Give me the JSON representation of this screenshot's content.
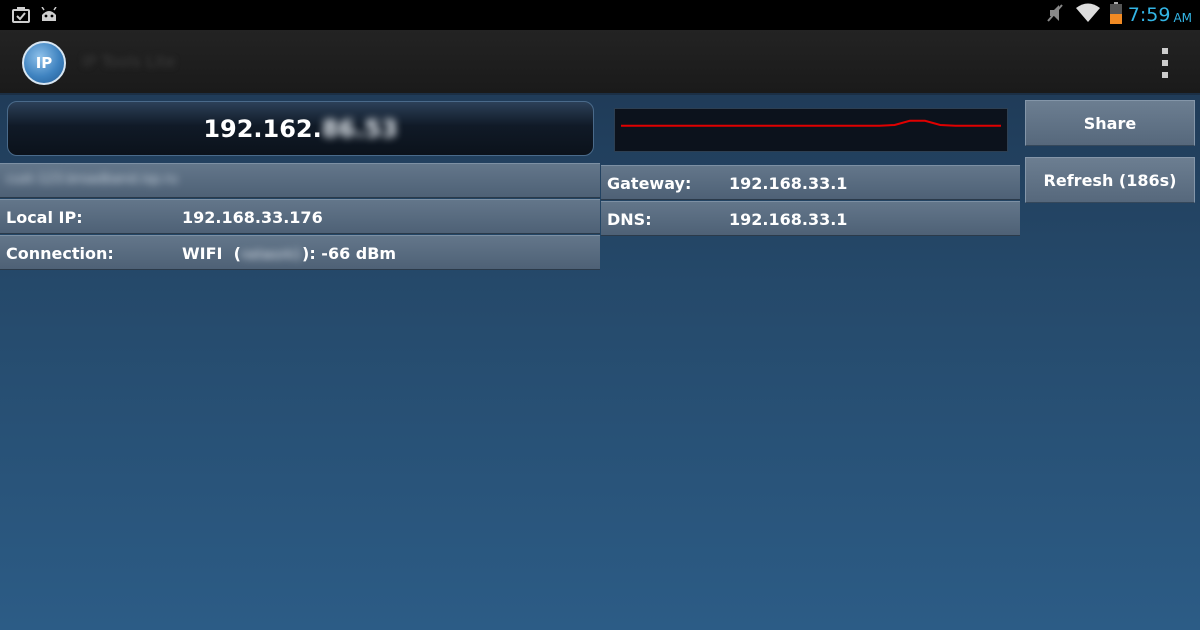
{
  "status_bar": {
    "left_icons": [
      "clipboard-check-icon",
      "android-debug-icon"
    ],
    "right_icons": [
      "sound-muted-icon",
      "wifi-icon",
      "battery-icon"
    ],
    "time": "7:59",
    "ampm": "AM",
    "accent_color": "#33b5e5"
  },
  "action_bar": {
    "app_icon_text": "IP",
    "app_title": "IP Tools Lite",
    "menu_icon": "overflow-menu-icon"
  },
  "ip_display": {
    "visible_part": "192.162.",
    "obscured_part": "86.53"
  },
  "hostname_row": {
    "value": "cust-123.broadband.isp.ru"
  },
  "info_left": [
    {
      "label": "Local IP:",
      "value": "192.168.33.176"
    },
    {
      "label": "Connection:",
      "value_prefix": "WIFI  (",
      "value_obscured": "network1",
      "value_suffix": "): -66 dBm"
    }
  ],
  "info_right": [
    {
      "label": "Gateway:",
      "value": "192.168.33.1"
    },
    {
      "label": "DNS:",
      "value": "192.168.33.1"
    }
  ],
  "buttons": {
    "share": "Share",
    "refresh": "Refresh (186s)"
  },
  "signal_graph": {
    "line_color": "#e00000",
    "values": [
      0.6,
      0.6,
      0.6,
      0.6,
      0.6,
      0.6,
      0.6,
      0.6,
      0.6,
      0.6,
      0.6,
      0.6,
      0.6,
      0.6,
      0.6,
      0.6,
      0.6,
      0.6,
      0.62,
      0.72,
      0.72,
      0.62,
      0.6,
      0.6,
      0.6,
      0.6
    ]
  }
}
